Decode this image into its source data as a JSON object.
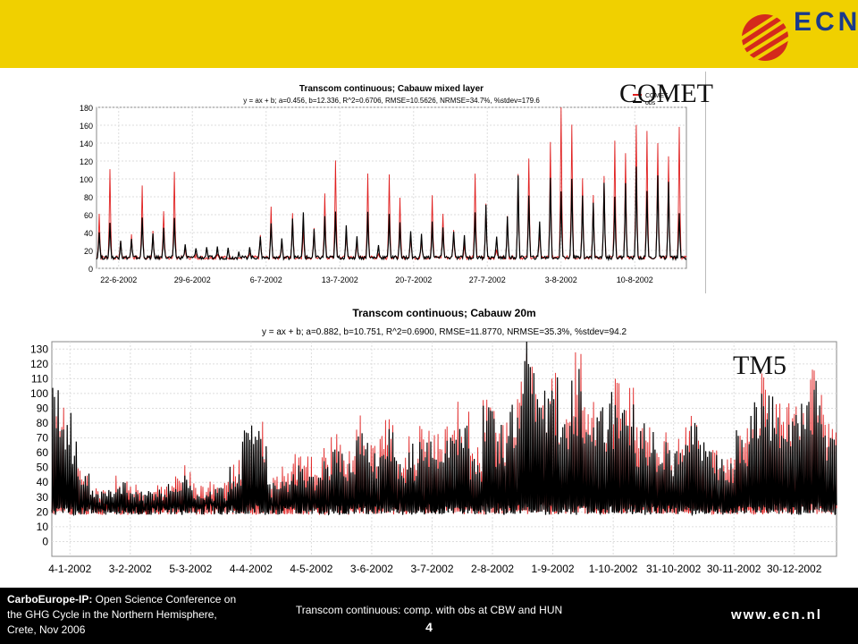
{
  "header": {
    "logo_text": "ECN",
    "colors": {
      "bar": "#f0d000",
      "logo_red": "#d42a1c",
      "logo_blue": "#1a3a8c"
    }
  },
  "labels": {
    "comet": "COMET",
    "tm5": "TM5"
  },
  "footer": {
    "left_bold": "CarboEurope-IP:",
    "left_text": " Open Science Conference on the GHG Cycle in the Northern Hemisphere, Crete, Nov 2006",
    "center_text": "Transcom continuous: comp. with obs at CBW and HUN",
    "page_number": "4",
    "url": "www.ecn.nl"
  },
  "chart_data": [
    {
      "type": "line",
      "title": "Transcom continuous; Cabauw mixed layer",
      "subtitle": "y = ax + b; a=0.456, b=12.336, R^2=0.6706, RMSE=10.5626, NRMSE=34.7%, %stdev=179.6",
      "legend": [
        "COMET",
        "obs"
      ],
      "legend_position": "top-right",
      "xlabel": "",
      "ylabel": "",
      "ylim": [
        0,
        180
      ],
      "yticks": [
        0,
        20,
        40,
        60,
        80,
        100,
        120,
        140,
        160,
        180
      ],
      "xtick_labels": [
        "22-6-2002",
        "29-6-2002",
        "6-7-2002",
        "13-7-2002",
        "20-7-2002",
        "27-7-2002",
        "3-8-2002",
        "10-8-2002"
      ],
      "grid": true,
      "days_span": 55,
      "series": [
        {
          "name": "COMET",
          "color": "#e02020",
          "daily_peaks": [
            60,
            110,
            30,
            35,
            90,
            40,
            60,
            105,
            20,
            12,
            10,
            15,
            10,
            8,
            15,
            35,
            65,
            30,
            60,
            40,
            45,
            80,
            120,
            40,
            30,
            105,
            15,
            105,
            75,
            35,
            30,
            80,
            60,
            40,
            25,
            105,
            70,
            20,
            55,
            105,
            120,
            40,
            140,
            180,
            160,
            100,
            80,
            100,
            140,
            125,
            160,
            150,
            140,
            125,
            155
          ]
        },
        {
          "name": "obs",
          "color": "#000000",
          "daily_peaks": [
            40,
            50,
            30,
            30,
            55,
            35,
            45,
            55,
            25,
            22,
            20,
            22,
            20,
            18,
            22,
            35,
            50,
            30,
            55,
            60,
            40,
            55,
            60,
            45,
            35,
            60,
            25,
            60,
            50,
            40,
            35,
            50,
            45,
            40,
            35,
            60,
            70,
            35,
            55,
            100,
            80,
            50,
            100,
            85,
            100,
            80,
            70,
            95,
            80,
            95,
            110,
            85,
            100,
            95,
            60
          ]
        }
      ]
    },
    {
      "type": "line",
      "title": "Transcom continuous; Cabauw 20m",
      "subtitle": "y = ax + b; a=0.882, b=10.751, R^2=0.6900, RMSE=11.8770, NRMSE=35.3%, %stdev=94.2",
      "xlabel": "",
      "ylabel": "",
      "ylim": [
        -10,
        135
      ],
      "yticks": [
        0,
        10,
        20,
        30,
        40,
        50,
        60,
        70,
        80,
        90,
        100,
        110,
        120,
        130
      ],
      "xtick_labels": [
        "4-1-2002",
        "3-2-2002",
        "5-3-2002",
        "4-4-2002",
        "4-5-2002",
        "3-6-2002",
        "3-7-2002",
        "2-8-2002",
        "1-9-2002",
        "1-10-2002",
        "31-10-2002",
        "30-11-2002",
        "30-12-2002"
      ],
      "grid": true,
      "days_span": 365,
      "series": [
        {
          "name": "TM5",
          "color": "#e02020",
          "weekly_peaks": [
            95,
            70,
            45,
            30,
            30,
            40,
            35,
            30,
            35,
            40,
            45,
            35,
            35,
            40,
            50,
            70,
            75,
            40,
            45,
            60,
            55,
            60,
            70,
            60,
            80,
            65,
            85,
            55,
            70,
            75,
            70,
            80,
            90,
            60,
            100,
            80,
            95,
            120,
            100,
            110,
            85,
            125,
            95,
            90,
            110,
            105,
            80,
            75,
            70,
            65,
            85,
            70,
            60,
            55,
            75,
            100,
            110,
            90,
            95,
            110,
            120,
            80
          ]
        },
        {
          "name": "obs",
          "color": "#000000",
          "weekly_peaks": [
            105,
            80,
            40,
            30,
            30,
            35,
            30,
            28,
            30,
            35,
            40,
            30,
            30,
            35,
            45,
            80,
            70,
            35,
            40,
            50,
            45,
            50,
            60,
            50,
            70,
            55,
            75,
            50,
            60,
            65,
            60,
            75,
            80,
            55,
            90,
            75,
            90,
            135,
            130,
            120,
            90,
            110,
            80,
            85,
            100,
            95,
            75,
            70,
            65,
            60,
            80,
            65,
            55,
            50,
            70,
            90,
            100,
            85,
            90,
            100,
            110,
            70
          ]
        }
      ]
    }
  ]
}
